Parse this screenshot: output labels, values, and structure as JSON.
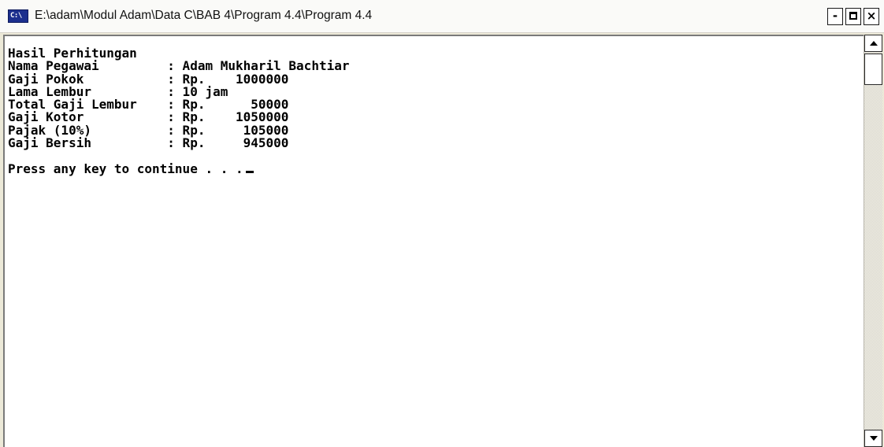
{
  "window": {
    "title": "E:\\adam\\Modul Adam\\Data C\\BAB 4\\Program 4.4\\Program 4.4",
    "icon": "console-icon",
    "icon_text": "C:\\",
    "controls": {
      "minimize": "-",
      "maximize": "maximize-icon",
      "close": "×"
    }
  },
  "console": {
    "lines": [
      "Hasil Perhitungan",
      "Nama Pegawai         : Adam Mukharil Bachtiar",
      "Gaji Pokok           : Rp.    1000000",
      "Lama Lembur          : 10 jam",
      "Total Gaji Lembur    : Rp.      50000",
      "Gaji Kotor           : Rp.    1050000",
      "Pajak (10%)          : Rp.     105000",
      "Gaji Bersih          : Rp.     945000",
      "",
      "Press any key to continue . . ."
    ]
  },
  "scrollbar": {
    "up_icon": "scroll-up-arrow-icon",
    "down_icon": "scroll-down-arrow-icon"
  }
}
